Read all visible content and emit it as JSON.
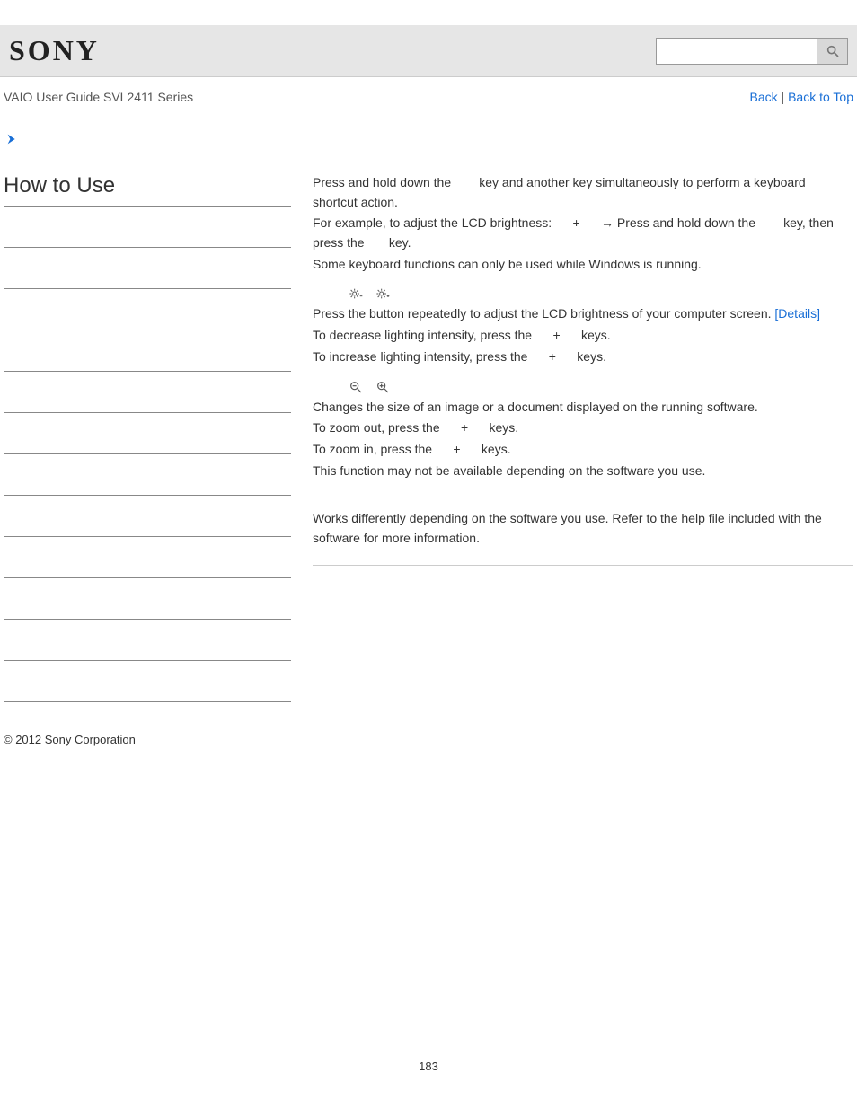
{
  "header": {
    "logo_text": "SONY",
    "search_placeholder": ""
  },
  "subheader": {
    "guide_title": "VAIO User Guide SVL2411 Series",
    "back_label": "Back",
    "sep": " | ",
    "top_label": "Back to Top"
  },
  "sidebar": {
    "title": "How to Use",
    "item_count": 12
  },
  "body": {
    "p1a": "Press and hold down the ",
    "p1b": " key and another key simultaneously to perform a keyboard shortcut action.",
    "p2a": "For example, to adjust the LCD brightness: ",
    "p2_plus": "+",
    "p2_arrow": " → Press and hold down the ",
    "p2c": " key, then press the ",
    "p2d": " key.",
    "p3": "Some keyboard functions can only be used while Windows is running.",
    "brightness": {
      "line1a": "Press the button repeatedly to adjust the LCD brightness of your computer screen. ",
      "details": "[Details]",
      "line2a": "To decrease lighting intensity, press the ",
      "plus": "+",
      "line2b": " keys.",
      "line3a": "To increase lighting intensity, press the ",
      "line3b": " keys."
    },
    "zoom": {
      "line1": "Changes the size of an image or a document displayed on the running software.",
      "line2a": "To zoom out, press the ",
      "plus": "+",
      "line2b": " keys.",
      "line3a": "To zoom in, press the ",
      "line3b": " keys.",
      "line4": "This function may not be available depending on the software you use."
    },
    "fkeys": {
      "line1": "Works differently depending on the software you use. Refer to the help file included with the software for more information."
    }
  },
  "footer": {
    "copyright": "© 2012 Sony Corporation",
    "page_number": "183"
  }
}
